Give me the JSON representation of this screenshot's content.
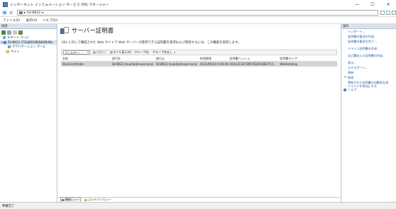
{
  "window": {
    "title": "インターネット インフォメーション サービス (IIS) マネージャー",
    "minimize": "—",
    "maximize": "☐",
    "close": "✕"
  },
  "address": {
    "back": "◀",
    "forward": "▶",
    "sep": "▸",
    "path": "SV-BK21",
    "sep2": "▸"
  },
  "menu": [
    "ファイル(F)",
    "表示(V)",
    "ヘルプ(H)"
  ],
  "connections": {
    "title": "接続",
    "tree": [
      {
        "label": "スタート ページ",
        "indent": 0
      },
      {
        "label": "SV-BK21 (TSUJIDODENSAN\\Wa",
        "indent": 0
      },
      {
        "label": "アプリケーション プール",
        "indent": 1
      },
      {
        "label": "サイト",
        "indent": 1
      }
    ]
  },
  "main": {
    "title": "サーバー証明書",
    "description": "SSL に対して構成された Web サイトで Web サーバーが使用できる証明書を要求および管理するには、この機能を使用します。",
    "filter_label": "フィルター:",
    "go_button": "検索(G)",
    "show_all_button": "すべて表示(A)",
    "group_by_label": "グループ化:",
    "group_by_value": "グループ化なし",
    "columns": [
      "名前",
      "発行先",
      "発行元",
      "有効期限",
      "証明書ハッシュ",
      "証明書ストア"
    ],
    "rows": [
      [
        "OwnCertificate",
        "SV-BK21.tsujidodensan.local",
        "SV-BK21.tsujidodensan.local",
        "2021/06/10 9:00:00",
        "A5A13F187D907D2AC8B27C5...",
        "WebHosting"
      ]
    ],
    "tabs": [
      "機能ビュー",
      "コンテンツ ビュー"
    ]
  },
  "actions": {
    "title": "操作",
    "items": [
      {
        "label": "インポート...",
        "type": "link"
      },
      {
        "label": "証明書の要求の作成...",
        "type": "link"
      },
      {
        "label": "証明書の要求の完了...",
        "type": "link"
      },
      {
        "label": "ドメイン証明書の作成...",
        "type": "link"
      },
      {
        "label": "自己署名入り証明書の作成...",
        "type": "link"
      },
      {
        "label": "表示...",
        "type": "link"
      },
      {
        "label": "エクスポート...",
        "type": "link"
      },
      {
        "label": "更新",
        "type": "link"
      },
      {
        "label": "削除",
        "type": "delete",
        "icon": "✕"
      },
      {
        "label": "更新された証明書の自動的な再バインドを有効にする",
        "type": "link"
      },
      {
        "label": "ヘルプ",
        "type": "help",
        "icon": "?"
      }
    ]
  },
  "status": {
    "text": "準備完了"
  }
}
